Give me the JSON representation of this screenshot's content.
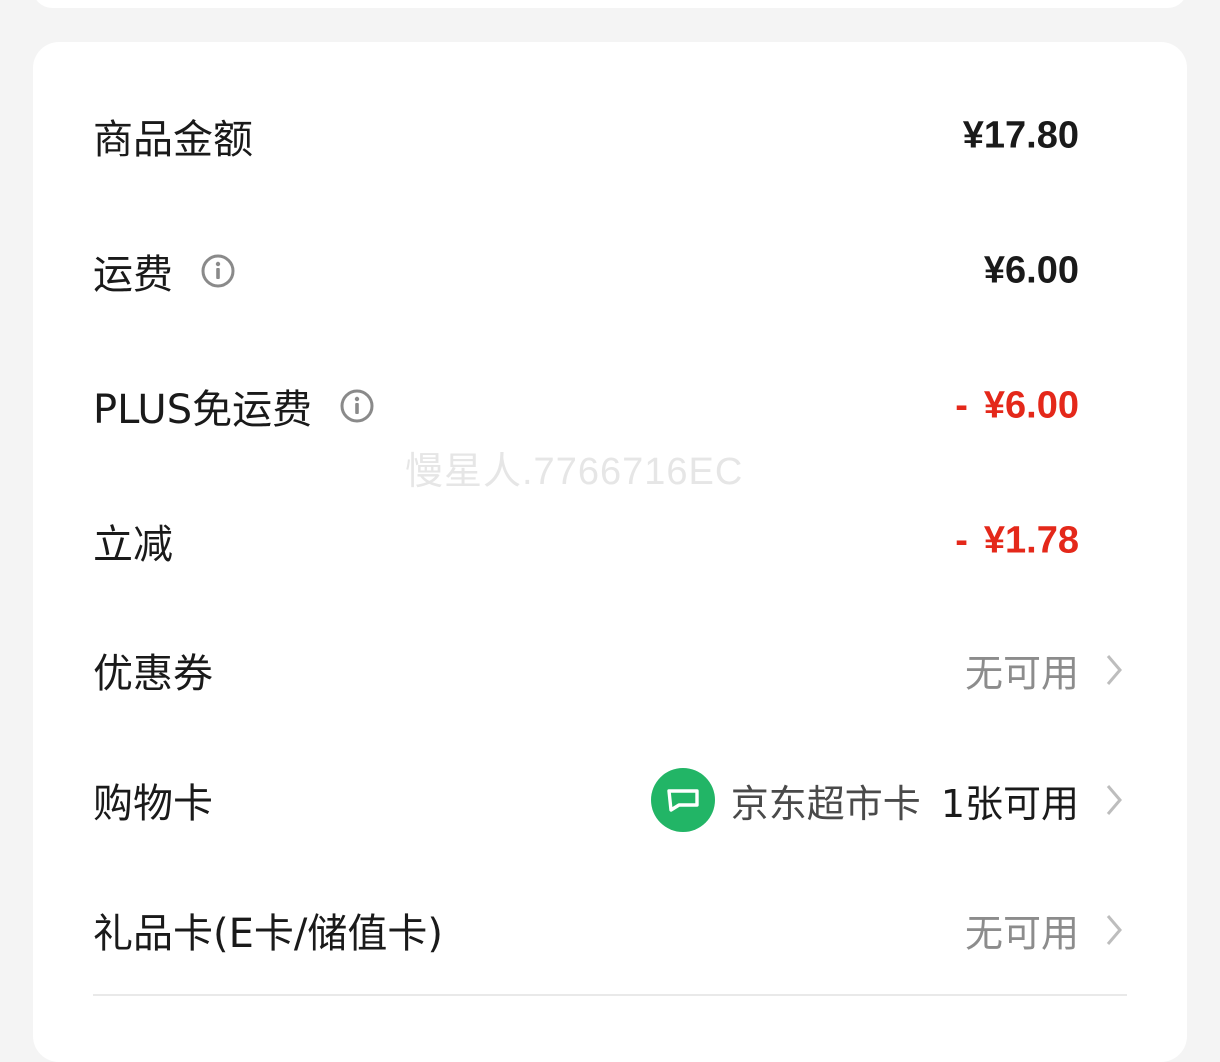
{
  "summary": {
    "goods_amount": {
      "label": "商品金额",
      "value": "¥17.80"
    },
    "shipping": {
      "label": "运费",
      "value": "¥6.00",
      "icon": "info-icon"
    },
    "plus_free_shipping": {
      "label": "PLUS免运费",
      "minus": "-",
      "value": "¥6.00",
      "icon": "info-icon",
      "color": "#e4281a"
    },
    "instant_discount": {
      "label": "立减",
      "minus": "-",
      "value": "¥1.78",
      "color": "#e4281a"
    },
    "coupon": {
      "label": "优惠券",
      "status": "无可用"
    },
    "shopping_card": {
      "label": "购物卡",
      "card_name": "京东超市卡",
      "count_text": "1张可用",
      "badge_color": "#22b566"
    },
    "gift_card": {
      "label": "礼品卡(E卡/储值卡)",
      "status": "无可用"
    }
  },
  "watermark": "慢星人.7766716EC"
}
